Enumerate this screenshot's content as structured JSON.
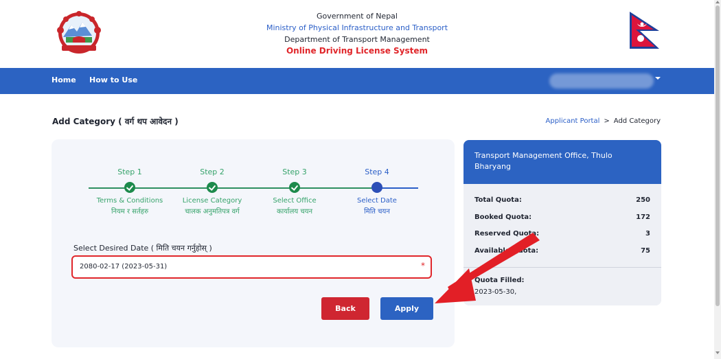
{
  "header": {
    "government": "Government of Nepal",
    "ministry": "Ministry of Physical Infrastructure and Transport",
    "department": "Department of Transport Management",
    "system": "Online Driving License System",
    "emblem_icon": "nepal-emblem-icon",
    "flag_icon": "nepal-flag-icon"
  },
  "nav": {
    "home": "Home",
    "how_to_use": "How to Use",
    "user_name": "",
    "user_caret_icon": "chevron-down-icon",
    "bg_color": "#2c63c2"
  },
  "page": {
    "title": "Add Category ( वर्ग थप आवेदन )",
    "breadcrumb": {
      "portal": "Applicant Portal",
      "separator": ">",
      "current": "Add Category"
    }
  },
  "steps": [
    {
      "title": "Step 1",
      "label_en": "Terms & Conditions",
      "label_np": "नियम र सर्तहरु",
      "status": "complete"
    },
    {
      "title": "Step 2",
      "label_en": "License Category",
      "label_np": "चालक अनुमतिपत्र वर्ग",
      "status": "complete"
    },
    {
      "title": "Step 3",
      "label_en": "Select Office",
      "label_np": "कार्यालय चयन",
      "status": "complete"
    },
    {
      "title": "Step 4",
      "label_en": "Select Date",
      "label_np": "मिति चयन",
      "status": "current"
    }
  ],
  "form": {
    "date_label": "Select Desired Date ( मिति चयन गर्नुहोस् )",
    "date_value": "2080-02-17 (2023-05-31)",
    "required_mark": "*",
    "back_label": "Back",
    "apply_label": "Apply"
  },
  "quota_panel": {
    "office": "Transport Management Office, Thulo Bharyang",
    "rows": [
      {
        "label": "Total Quota:",
        "value": "250"
      },
      {
        "label": "Booked Quota:",
        "value": "172"
      },
      {
        "label": "Reserved Quota:",
        "value": "3"
      },
      {
        "label": "Available Quota:",
        "value": "75"
      }
    ],
    "filled_label": "Quota Filled:",
    "filled_date": "2023-05-30,"
  },
  "colors": {
    "primary": "#2c63c2",
    "success": "#1d8a4c",
    "danger": "#cf2631",
    "annotation": "#e0262a"
  }
}
